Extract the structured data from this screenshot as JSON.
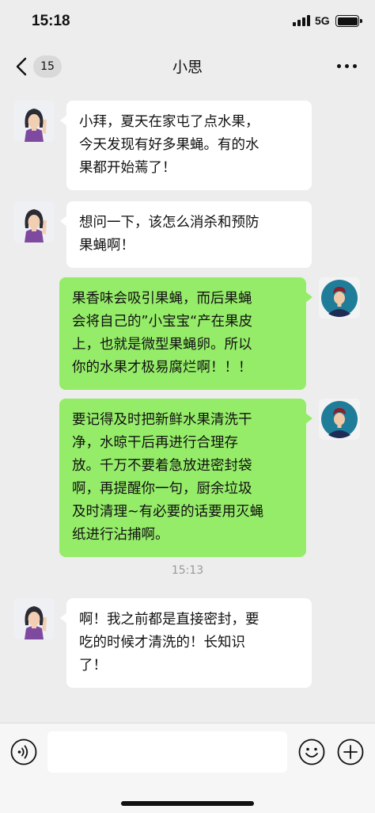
{
  "status_bar": {
    "time": "15:18",
    "network": "5G"
  },
  "nav": {
    "unread_count": "15",
    "title": "小思"
  },
  "messages": [
    {
      "side": "in",
      "lines": [
        "小拜，夏天在家屯了点水果，",
        "今天发现有好多果蝇。有的水",
        "果都开始蔫了！"
      ]
    },
    {
      "side": "in",
      "lines": [
        "想问一下，该怎么消杀和预防",
        "果蝇啊！"
      ]
    },
    {
      "side": "out",
      "lines": [
        "果香味会吸引果蝇，而后果蝇",
        "会将自己的”小宝宝“产在果皮",
        "上，也就是微型果蝇卵。所以",
        "你的水果才极易腐烂啊！！！"
      ]
    },
    {
      "side": "out",
      "lines": [
        "要记得及时把新鲜水果清洗干",
        "净，水晾干后再进行合理存",
        "放。千万不要着急放进密封袋",
        "啊，再提醒你一句，厨余垃圾",
        "及时清理~有必要的话要用灭蝇",
        "纸进行沾捕啊。"
      ]
    },
    {
      "side": "in",
      "lines": [
        "啊！我之前都是直接密封，要",
        "吃的时候才清洗的！长知识",
        "了！"
      ]
    }
  ],
  "timestamp": "15:13",
  "input": {
    "value": "",
    "placeholder": ""
  },
  "icons": {
    "back": "chevron-left-icon",
    "more": "more-dots-icon",
    "voice": "voice-icon",
    "emoji": "emoji-icon",
    "plus": "plus-icon"
  },
  "colors": {
    "background": "#ededed",
    "incoming_bubble": "#ffffff",
    "outgoing_bubble": "#95ec69",
    "timestamp": "#999999"
  }
}
